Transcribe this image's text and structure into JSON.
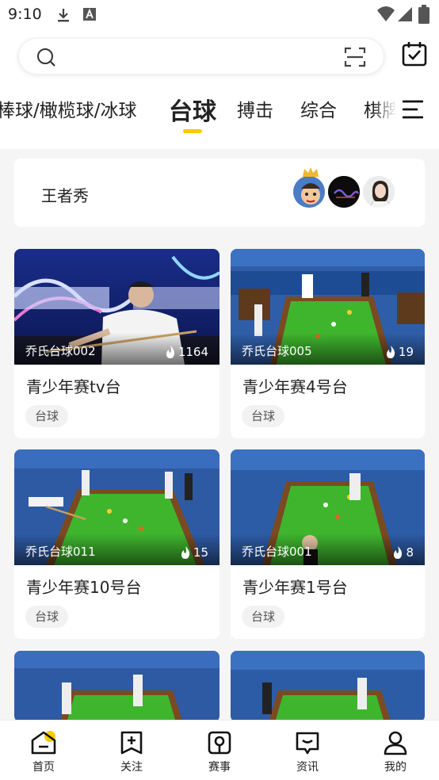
{
  "status_bar": {
    "time": "9:10"
  },
  "search": {
    "placeholder": ""
  },
  "tabs": [
    {
      "label": "棒球/橄榄球/冰球"
    },
    {
      "label": "台球",
      "active": true
    },
    {
      "label": "搏击"
    },
    {
      "label": "综合"
    },
    {
      "label": "棋牌"
    }
  ],
  "feature": {
    "title": "王者秀",
    "avatar_count": 3
  },
  "cards": [
    {
      "channel": "乔氏台球002",
      "heat": "1164",
      "title": "青少年赛tv台",
      "tag": "台球"
    },
    {
      "channel": "乔氏台球005",
      "heat": "19",
      "title": "青少年赛4号台",
      "tag": "台球"
    },
    {
      "channel": "乔氏台球011",
      "heat": "15",
      "title": "青少年赛10号台",
      "tag": "台球"
    },
    {
      "channel": "乔氏台球001",
      "heat": "8",
      "title": "青少年赛1号台",
      "tag": "台球"
    },
    {
      "channel": "",
      "heat": "",
      "title": "",
      "tag": ""
    },
    {
      "channel": "",
      "heat": "",
      "title": "",
      "tag": ""
    }
  ],
  "bottom_nav": [
    {
      "label": "首页",
      "icon": "home-icon",
      "active": true
    },
    {
      "label": "关注",
      "icon": "bookmark-plus-icon"
    },
    {
      "label": "赛事",
      "icon": "match-icon"
    },
    {
      "label": "资讯",
      "icon": "news-icon"
    },
    {
      "label": "我的",
      "icon": "profile-icon"
    }
  ],
  "colors": {
    "accent": "#ffc900",
    "table_green": "#3fb52e",
    "venue_blue": "#2f5ea8"
  }
}
